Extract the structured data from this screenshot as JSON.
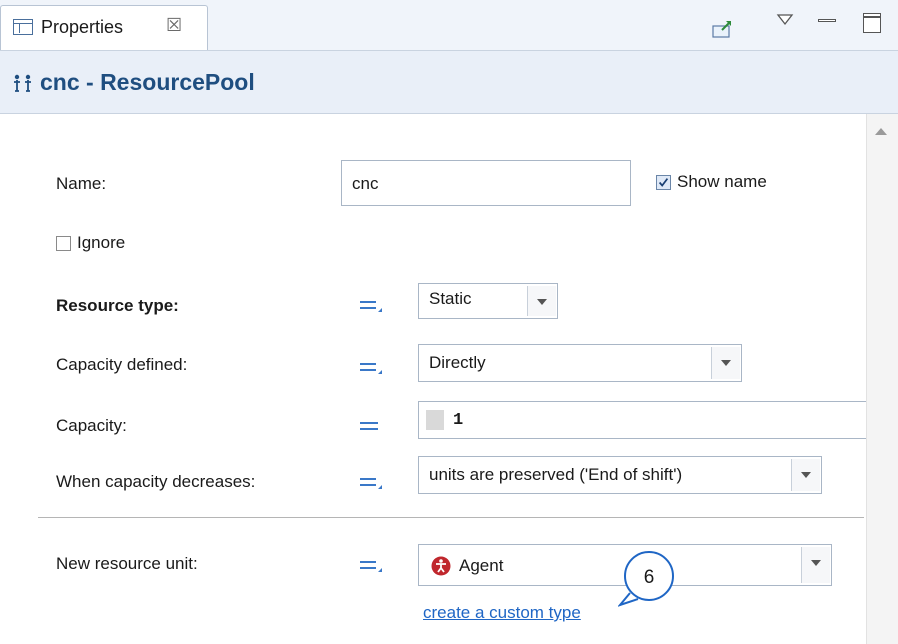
{
  "tab": {
    "title": "Properties",
    "close_icon": "☒"
  },
  "header": {
    "title": "cnc - ResourcePool"
  },
  "form": {
    "name": {
      "label": "Name:",
      "value": "cnc"
    },
    "show_name": {
      "label": "Show name",
      "checked": true
    },
    "ignore": {
      "label": "Ignore",
      "checked": false
    },
    "resource_type": {
      "label": "Resource type:",
      "value": "Static"
    },
    "capacity_defined": {
      "label": "Capacity defined:",
      "value": "Directly"
    },
    "capacity": {
      "label": "Capacity:",
      "value": "1"
    },
    "capacity_decreases": {
      "label": "When capacity decreases:",
      "value": "units are preserved ('End of shift')"
    },
    "new_resource_unit": {
      "label": "New resource unit:",
      "value": "Agent"
    },
    "create_custom_type": {
      "label": "create a custom type"
    }
  },
  "callout": {
    "number": "6"
  },
  "colors": {
    "header_title": "#1f4e80",
    "link": "#1f66c5",
    "agent_icon": "#c0272d",
    "eq_icon": "#3a78c8"
  }
}
